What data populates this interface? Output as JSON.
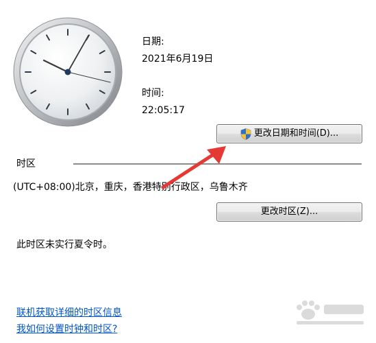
{
  "date": {
    "label": "日期:",
    "value": "2021年6月19日"
  },
  "time": {
    "label": "时间:",
    "value": "22:05:17"
  },
  "change_datetime_button": {
    "label": "更改日期和时间(D)..."
  },
  "timezone": {
    "section_label": "时区",
    "value": "(UTC+08:00)北京，重庆，香港特别行政区，乌鲁木齐",
    "change_button_label": "更改时区(Z)...",
    "dst_note": "此时区未实行夏令时。"
  },
  "links": {
    "online_info": "联机获取详细的时区信息",
    "how_to_set": "我如何设置时钟和时区?"
  },
  "colors": {
    "link": "#0055cc",
    "arrow": "#e53935"
  }
}
